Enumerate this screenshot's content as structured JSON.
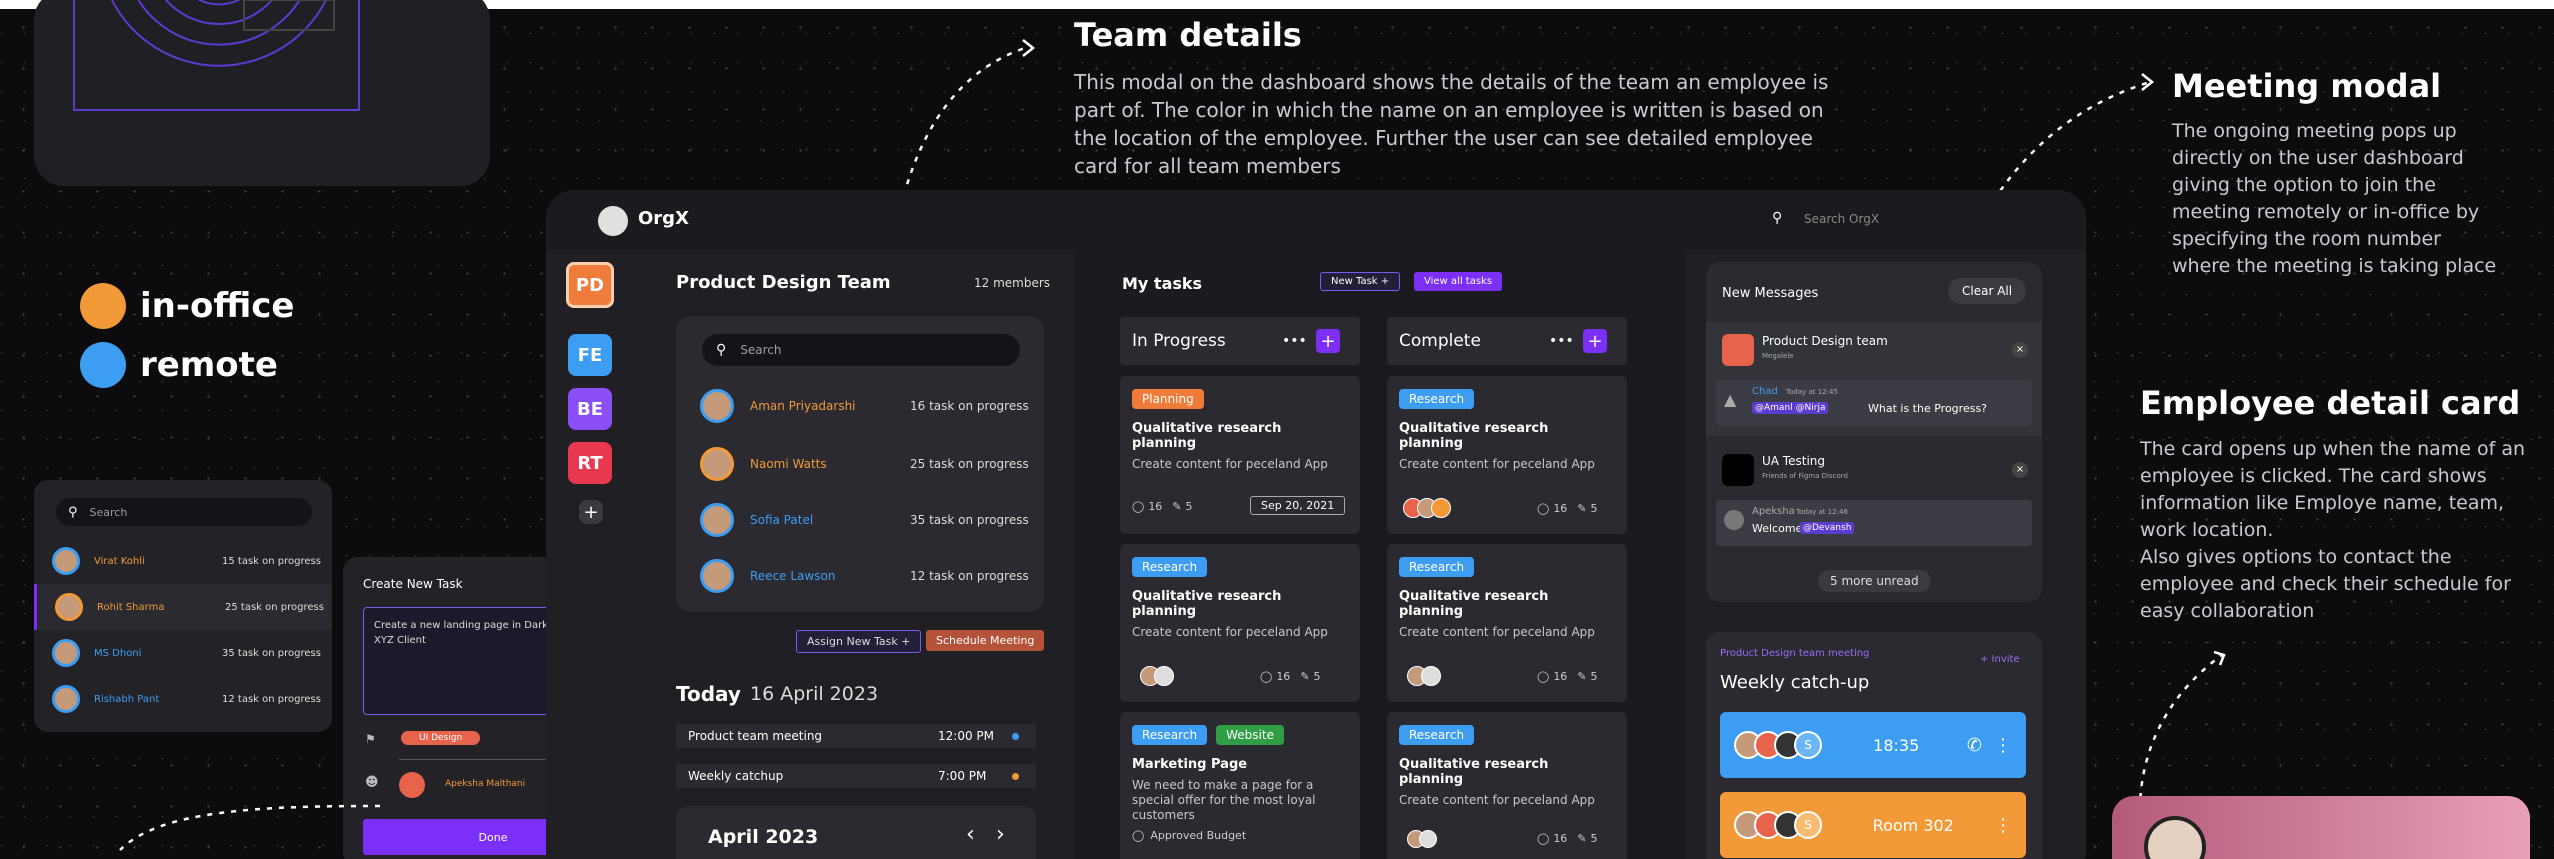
{
  "legend": {
    "in_office": "in-office",
    "remote": "remote",
    "in_office_color": "#f29a37",
    "remote_color": "#3d9df2"
  },
  "left_list": {
    "search_placeholder": "Search",
    "rows": [
      {
        "name": "Virat Kohli",
        "tasks": "15 task on progress",
        "color": "#f29a37"
      },
      {
        "name": "Rohit Sharma",
        "tasks": "25 task on progress",
        "color": "#f29a37"
      },
      {
        "name": "MS Dhoni",
        "tasks": "35 task on progress",
        "color": "#3d9df2"
      },
      {
        "name": "Rishabh Pant",
        "tasks": "12 task on progress",
        "color": "#3d9df2"
      }
    ]
  },
  "create_task": {
    "title": "Create New Task",
    "close": "×",
    "description": "Create a new landing page in  Dark mode for  XYZ Client",
    "tag": "UI Design",
    "assignee": "Apeksha Malthani",
    "done": "Done"
  },
  "annotations": {
    "team_title": "Team details",
    "team_body": "This modal on the dashboard shows the details of the team an employee is part of. The color in which the name on an employee is written is based on the location of the employee. Further the user can see detailed employee card for all team members",
    "meeting_title": "Meeting modal",
    "meeting_body": "The ongoing meeting pops up directly on the user dashboard giving the option to join the meeting remotely or in-office by specifying the room number where the meeting is taking place",
    "employee_title": "Employee detail card",
    "employee_body": "The card opens up when the name of an employee is clicked. The card shows information like Employe name, team, work location.\nAlso gives options to contact the employee and check their schedule for easy collaboration"
  },
  "app": {
    "logo": "OrgX",
    "search_placeholder": "Search OrgX",
    "teams": [
      {
        "label": "PD",
        "color": "#f07c3c"
      },
      {
        "label": "FE",
        "color": "#3d9df2"
      },
      {
        "label": "BE",
        "color": "#8b4ff5"
      },
      {
        "label": "RT",
        "color": "#e8384f"
      }
    ],
    "add_team": "+",
    "team_panel": {
      "title": "Product Design Team",
      "members": "12 members",
      "search_placeholder": "Search",
      "rows": [
        {
          "name": "Aman Priyadarshi",
          "tasks": "16 task on progress",
          "color": "#f29a37"
        },
        {
          "name": "Naomi Watts",
          "tasks": "25 task on progress",
          "color": "#f29a37"
        },
        {
          "name": "Sofia Patel",
          "tasks": "35 task on progress",
          "color": "#3d9df2"
        },
        {
          "name": "Reece Lawson",
          "tasks": "12 task on progress",
          "color": "#3d9df2"
        }
      ],
      "assign_btn": "Assign New Task +",
      "schedule_btn": "Schedule Meeting"
    },
    "today": {
      "label": "Today",
      "date": "16 April 2023",
      "events": [
        {
          "name": "Product team meeting",
          "time": "12:00 PM",
          "color": "#3d9df2"
        },
        {
          "name": "Weekly catchup",
          "time": "7:00 PM",
          "color": "#f29a37"
        }
      ],
      "month": "April 2023",
      "prev": "‹",
      "next": "›"
    },
    "tasks": {
      "title": "My tasks",
      "new_task": "New Task +",
      "view_all": "View all tasks",
      "in_progress": "In Progress",
      "complete": "Complete",
      "more": "•••",
      "plus": "+",
      "cards_left": [
        {
          "tags": [
            {
              "text": "Planning",
              "color": "#f07c3c"
            }
          ],
          "title": "Qualitative research planning",
          "sub": "Create content for peceland App",
          "comments": "16",
          "attach": "5",
          "date": "Sep 20, 2021"
        },
        {
          "tags": [
            {
              "text": "Research",
              "color": "#3d9df2"
            }
          ],
          "title": "Qualitative research planning",
          "sub": "Create content for peceland App",
          "comments": "16",
          "attach": "5",
          "date": ""
        },
        {
          "tags": [
            {
              "text": "Research",
              "color": "#3d9df2"
            },
            {
              "text": "Website",
              "color": "#2f9e44"
            }
          ],
          "title": "Marketing Page",
          "sub": "We need to make a page for a special offer for the most loyal customers",
          "extra": "Approved Budget"
        }
      ],
      "cards_right": [
        {
          "tags": [
            {
              "text": "Research",
              "color": "#3d9df2"
            }
          ],
          "title": "Qualitative research planning",
          "sub": "Create content for peceland App",
          "comments": "16",
          "attach": "5"
        },
        {
          "tags": [
            {
              "text": "Research",
              "color": "#3d9df2"
            }
          ],
          "title": "Qualitative research planning",
          "sub": "Create content for peceland App",
          "comments": "16",
          "attach": "5"
        },
        {
          "tags": [
            {
              "text": "Research",
              "color": "#3d9df2"
            }
          ],
          "title": "Qualitative research planning",
          "sub": "Create content for peceland App",
          "comments": "16",
          "attach": "5"
        }
      ]
    },
    "messages": {
      "title": "New Messages",
      "clear": "Clear All",
      "groups": [
        {
          "name": "Product Design team",
          "sub": "Megalele",
          "sender": "Chad",
          "time": "Today at 12:45",
          "mentions": "@Amanl @Nirja",
          "text": "What is the Progress?"
        },
        {
          "name": "UA Testing",
          "sub": "Friends of Figma Discord",
          "sender": "Apeksha",
          "time": "Today at 12:46",
          "mentions": "@Devansh",
          "text": "Welcome"
        }
      ],
      "more": "5 more unread"
    },
    "meeting": {
      "team": "Product Design team meeting",
      "invite": "+ Invite",
      "title": "Weekly catch-up",
      "remote_time": "18:35",
      "room": "Room 302",
      "count": "S"
    }
  }
}
